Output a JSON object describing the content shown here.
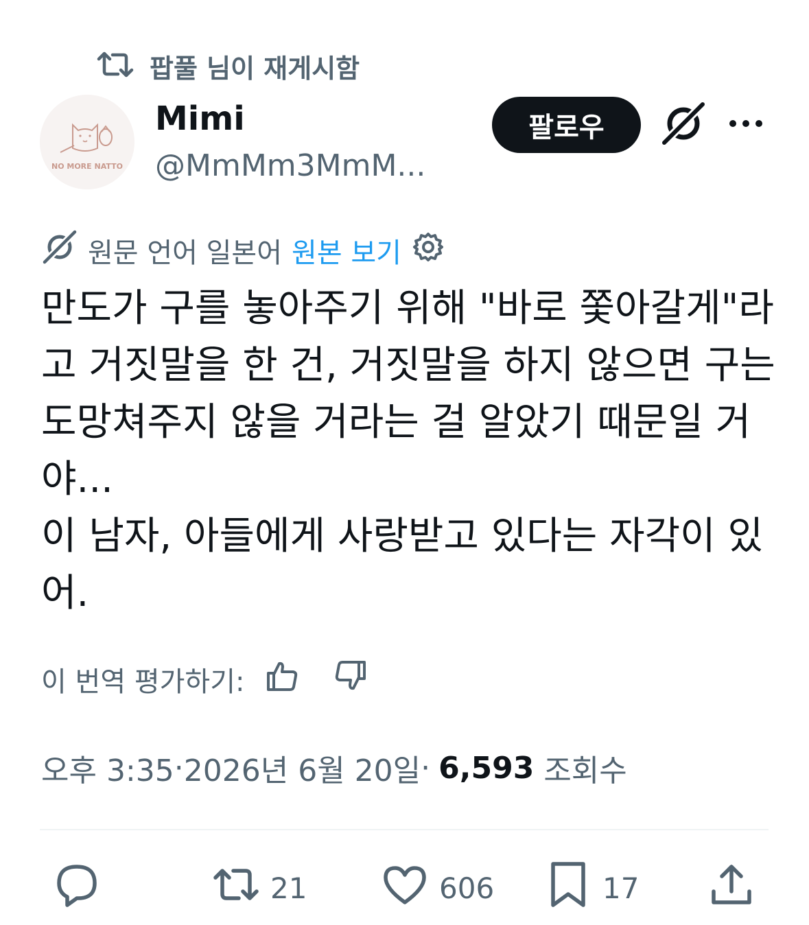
{
  "repost": {
    "icon": "repost-icon",
    "label": "팝풀 님이 재게시함"
  },
  "author": {
    "avatar_text": "NO MORE NATTO",
    "display_name": "Mimi",
    "handle": "@MmMm3MmM..."
  },
  "header_actions": {
    "follow_label": "팔로우",
    "grok_icon": "grok-icon",
    "more_icon": "more-icon"
  },
  "translation": {
    "source_text": "원문 언어 일본어",
    "view_original_label": "원본 보기",
    "settings_icon": "gear-icon"
  },
  "tweet": {
    "lines": [
      "만도가 구를 놓아주기 위해 \"바로 쫓아갈게\"라",
      "고 거짓말을 한 건, 거짓말을 하지 않으면 구는",
      "도망쳐주지 않을 거라는 걸 알았기 때문일 거",
      "야...",
      "이 남자, 아들에게 사랑받고 있다는 자각이 있",
      "어."
    ]
  },
  "rating": {
    "label": "이 번역 평가하기:",
    "thumbs_up_icon": "thumbs-up-icon",
    "thumbs_down_icon": "thumbs-down-icon"
  },
  "meta": {
    "time": "오후 3:35",
    "separator": " · ",
    "date": "2026년 6월 20일",
    "views": "6,593",
    "views_label": "조회수"
  },
  "actions": {
    "reply": {
      "icon": "reply-icon",
      "count": ""
    },
    "repost": {
      "icon": "repost-icon",
      "count": "21"
    },
    "like": {
      "icon": "heart-icon",
      "count": "606"
    },
    "bookmark": {
      "icon": "bookmark-icon",
      "count": "17"
    },
    "share": {
      "icon": "share-icon",
      "count": ""
    }
  },
  "colors": {
    "text_primary": "#0f1419",
    "text_secondary": "#536471",
    "link": "#1d9bf0",
    "follow_bg": "#0f1419",
    "divider": "#eff3f4"
  }
}
